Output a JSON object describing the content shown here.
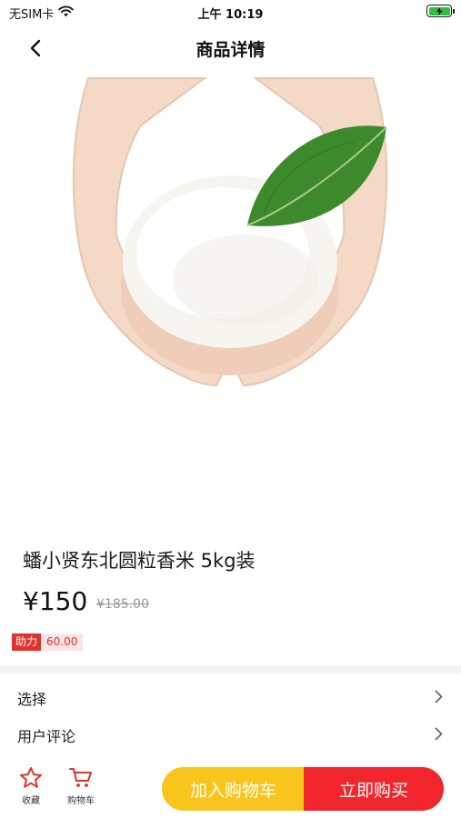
{
  "status_bar": {
    "carrier": "无SIM卡",
    "time": "上午 10:19",
    "battery_color": "#2fbf3e"
  },
  "nav": {
    "back_icon": "chevron-left-icon",
    "title": "商品详情"
  },
  "product": {
    "image_description": "cupped-hands-holding-rice-with-green-leaf",
    "title": "蟠小贤东北圆粒香米 5kg装",
    "price": "¥150",
    "original_price": "¥185.00",
    "assist_label": "助力",
    "assist_value": "60.00"
  },
  "options": {
    "select_label": "选择",
    "review_label": "用户评论"
  },
  "bottom_bar": {
    "favorite_label": "收藏",
    "favorite_icon": "star-icon",
    "cart_label": "购物车",
    "cart_icon": "cart-icon",
    "add_to_cart_label": "加入购物车",
    "buy_now_label": "立即购买"
  },
  "colors": {
    "accent_red": "#e2302d",
    "add_to_cart_yellow": "#f8c51c",
    "buy_now_red": "#f0262c"
  }
}
